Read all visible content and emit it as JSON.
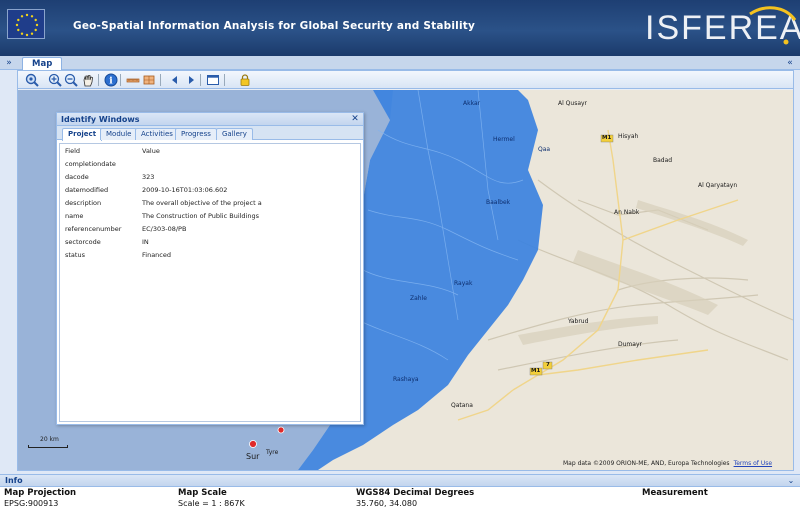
{
  "header": {
    "title": "Geo-Spatial Information Analysis for Global Security and Stability",
    "logo_text": "ISFEREA"
  },
  "tabs": [
    {
      "label": "Map"
    }
  ],
  "identify_window": {
    "title": "Identify Windows",
    "tabs": [
      "Project",
      "Module",
      "Activities",
      "Progress",
      "Gallery"
    ],
    "active_tab": "Project",
    "columns": {
      "field": "Field",
      "value": "Value"
    },
    "rows": [
      {
        "field": "completiondate",
        "value": ""
      },
      {
        "field": "dacode",
        "value": "323"
      },
      {
        "field": "datemodified",
        "value": "2009-10-16T01:03:06.602"
      },
      {
        "field": "description",
        "value": "The overall objective of the project a"
      },
      {
        "field": "name",
        "value": "The Construction of Public Buildings"
      },
      {
        "field": "referencenumber",
        "value": "EC/303-08/PB"
      },
      {
        "field": "sectorcode",
        "value": "IN"
      },
      {
        "field": "status",
        "value": "Financed"
      }
    ]
  },
  "map": {
    "labels": {
      "al_qusayr": "Al Qusayr",
      "hisyah": "Hisyah",
      "badad": "Badad",
      "al_qaryatayn": "Al Qaryatayn",
      "an_nabk": "An Nabk",
      "yabrud": "Yabrud",
      "dumayr": "Dumayr",
      "qatana": "Qatana",
      "baalbek": "Baalbek",
      "hermel": "Hermel",
      "akkar": "Akkar",
      "zahle": "Zahle",
      "rayak": "Rayak",
      "rashaya": "Rashaya",
      "tyre": "Tyre",
      "sur": "Sur",
      "qaa": "Qaa"
    },
    "road_badges": [
      "M1",
      "M1",
      "7"
    ],
    "scale_label": "20 km",
    "attribution": "Map data ©2009 ORION-ME, AND, Europa Technologies",
    "terms": "Terms of Use"
  },
  "toolbar_icons": [
    "zoom-extent-icon",
    "zoom-in-icon",
    "zoom-out-icon",
    "pan-hand-icon",
    "info-icon",
    "measure-line-icon",
    "measure-area-icon",
    "previous-extent-icon",
    "next-extent-icon",
    "window-icon",
    "lock-icon"
  ],
  "info_panel": {
    "title": "Info",
    "columns": [
      {
        "header": "Map Projection",
        "value": "EPSG:900913"
      },
      {
        "header": "Map Scale",
        "value": "Scale = 1 : 867K"
      },
      {
        "header": "WGS84 Decimal Degrees",
        "value": "35.760, 34.080"
      },
      {
        "header": "Measurement",
        "value": ""
      }
    ]
  },
  "colors": {
    "header_bg": "#1e3f73",
    "panel_border": "#99bbe8",
    "lebanon_fill": "#3b82e0",
    "map_land": "#e8e4d8"
  }
}
